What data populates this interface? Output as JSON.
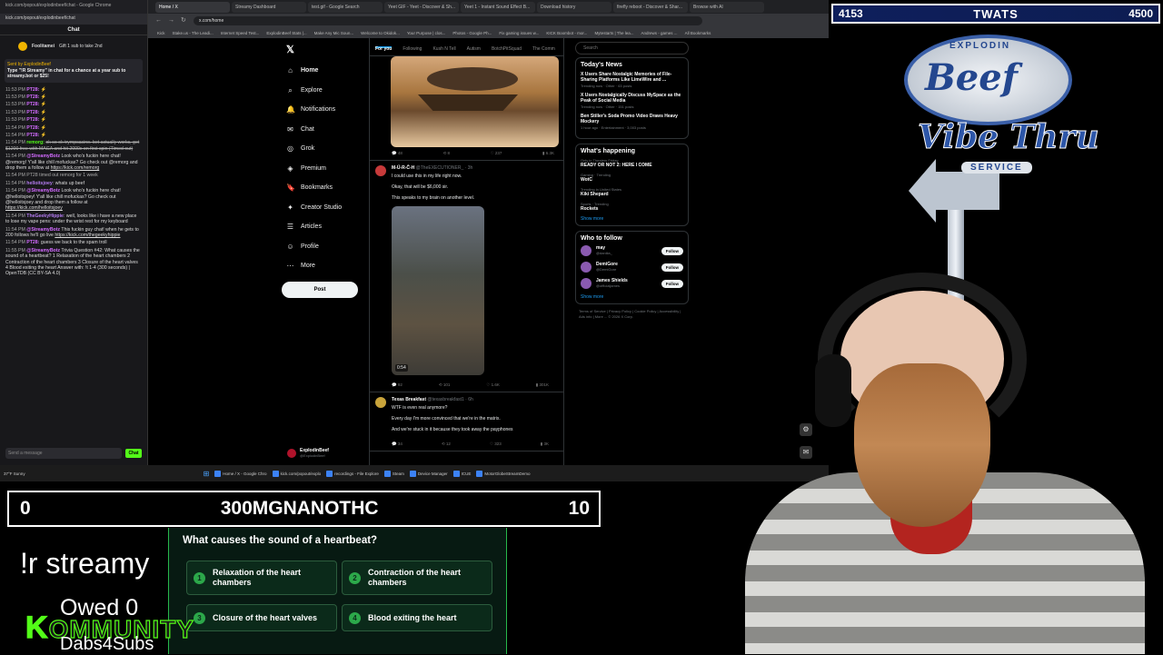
{
  "chat": {
    "title": "kick.com/popout/explodinbeef/chat - Google Chrome",
    "url": "kick.com/popout/explodinbeef/chat",
    "header": "Chat",
    "gift_user": "Foolitamei",
    "gift_text": "Gift 1 sub to take 2nd",
    "pinned_by": "Sent by ExplodinBeef",
    "pinned_text": "Type \"!R Streamy\" in chat for a chance at a year sub to streamy.bot or $25!",
    "lines": [
      {
        "time": "11:53 PM",
        "user": "PT28:",
        "text": "",
        "cls": "p"
      },
      {
        "time": "11:53 PM",
        "user": "PT28:",
        "text": "",
        "cls": "p"
      },
      {
        "time": "11:53 PM",
        "user": "PT28:",
        "text": "",
        "cls": "p"
      },
      {
        "time": "11:53 PM",
        "user": "PT28:",
        "text": "",
        "cls": "p"
      },
      {
        "time": "11:53 PM",
        "user": "PT28:",
        "text": "",
        "cls": "p"
      },
      {
        "time": "11:54 PM",
        "user": "PT28:",
        "text": "",
        "cls": "p"
      },
      {
        "time": "11:54 PM",
        "user": "PT28:",
        "text": "",
        "cls": "p"
      }
    ],
    "remorg_time": "11:54 PM",
    "remorg_user": "remorg:",
    "remorg_text": "ok so ok trympcasino. bet actually works, get $1200 free with MAGA and hit 2000x on first spin (Timed out)",
    "bot1_time": "11:54 PM",
    "bot1_user": "@StreamyBotz",
    "bot1_text": "Look who's fuckin here chat! @remorg! Y'all like chill mofuckas? Go check out @remorg and drop them a follow at",
    "bot1_link": "https://kick.com/remorg",
    "timeout_time": "11:54 PM",
    "timeout_text": "PT28 timed out remorg for 1 week",
    "hello_time": "11:54 PM",
    "hello_user": "helloitsjoey",
    "hello_text": ": whats up beef",
    "bot2_time": "11:54 PM",
    "bot2_user": "@StreamyBotz",
    "bot2_text": "Look who's fuckin here chat! @helloitsjoey! Y'all like chill mofuckas? Go check out @helloitsjoey and drop them a follow at",
    "bot2_link": "https://kick.com/helloitsjoey",
    "geeky_time": "11:54 PM",
    "geeky_user": "TheGeekyHippie",
    "geeky_text": ": well, looks like i have a new place to lose my vape pens: under the wrist rest for my keyboard",
    "bot3_time": "11:54 PM",
    "bot3_user": "@StreamyBotz",
    "bot3_text": "This fuckin guy chat! when he gets to 200 follows he'll go live",
    "bot3_link": "https://kick.com/thegeekyhippie",
    "pt_time": "11:54 PM",
    "pt_user": "PT28:",
    "pt_text": "guess we back to the spam troll",
    "trivia_time": "11:55 PM",
    "trivia_user": "@StreamyBotz",
    "trivia_text": "Trivia Question #42: What causes the sound of a heartbeat? 1 Relaxation of the heart chambers 2 Contraction of the heart chambers 3 Closure of the heart valves 4 Blood exiting the heart Answer with: !t 1-4 (300 seconds) | OpenTDB (CC BY-SA 4.0)",
    "input_placeholder": "Send a message",
    "send_label": "Chat"
  },
  "browser": {
    "tabs": [
      "Home / X",
      "Streamy Dashboard",
      "test.gif - Google Search",
      "Yeet GIF - Yeet - Discover & Sh...",
      "Yeet 1 - Instant Sound Effect B...",
      "Download history",
      "firefly reboot - Discover & Shar...",
      "Browse with AI"
    ],
    "address": "x.com/home",
    "bookmarks": [
      "Kick",
      "Stake.us - The Leadi...",
      "Internet Speed Test...",
      "ExplodinBeef Stats |...",
      "Make Any Mic Soun...",
      "Welcome to Okidok...",
      "Your Purpose | clos...",
      "Photos - Google Ph...",
      "Fix gaming issues w...",
      "KICK Boombot - mor...",
      "Mytestarts | The lea...",
      "Andrews - games ...",
      "All Bookmarks"
    ]
  },
  "x": {
    "nav": [
      "Home",
      "Explore",
      "Notifications",
      "Chat",
      "Grok",
      "Premium",
      "Bookmarks",
      "Creator Studio",
      "Articles",
      "Profile",
      "More"
    ],
    "post_label": "Post",
    "account_name": "ExplodinBeef",
    "account_handle": "@ExplodinBeef",
    "feed_tabs": [
      "For you",
      "Following",
      "Kush N Tell",
      "Autism",
      "BotchPitSquad",
      "The Comm"
    ],
    "tweet0_actions": [
      "48",
      "8",
      "237",
      "6.3K"
    ],
    "tweet1_name": "M-Ü-R-Ĉ-H",
    "tweet1_handle": "@TheEXECUTIONER_ · 3h",
    "tweet1_lines": [
      "I could use this in my life right now.",
      "Okay, that will be $6,000 sir.",
      "This speaks to my brain on another level."
    ],
    "tweet1_video_time": "0:54",
    "tweet1_actions": [
      "92",
      "101",
      "1.6K",
      "301K"
    ],
    "tweet2_name": "Texas Breakfast",
    "tweet2_handle": "@texasbreakfast1 · 6h",
    "tweet2_lines": [
      "WTF is even real anymore?",
      "Every day I'm more convinced that we're in the matrix.",
      "And we're stuck in it because they took away the payphones"
    ],
    "tweet2_actions": [
      "34",
      "12",
      "323",
      "3K"
    ],
    "search_placeholder": "Search",
    "news_title": "Today's News",
    "news": [
      {
        "title": "X Users Share Nostalgic Memories of File-Sharing Platforms Like LimeWire and ...",
        "meta": "Trending now · Other · 63 posts"
      },
      {
        "title": "X Users Nostalgically Discuss MySpace as the Peak of Social Media",
        "meta": "Trending now · Other · 151 posts"
      },
      {
        "title": "Ben Stiller's Soda Promo Video Draws Heavy Mockery",
        "meta": "1 hour ago · Entertainment · 3,003 posts"
      }
    ],
    "happening_title": "What's happening",
    "trends": [
      {
        "cat": "Only in Theaters Friday",
        "name": "READY OR NOT 2: HERE I COME"
      },
      {
        "cat": "Gaming · Trending",
        "name": "WotC"
      },
      {
        "cat": "Trending in United States",
        "name": "Kiki Shepard"
      },
      {
        "cat": "Sports · Trending",
        "name": "Rockets"
      }
    ],
    "show_more": "Show more",
    "follow_title": "Who to follow",
    "follows": [
      {
        "name": "may",
        "handle": "@daniiia_"
      },
      {
        "name": "DemiGore",
        "handle": "@DemiGore"
      },
      {
        "name": "James Shields",
        "handle": "@officialjames"
      }
    ],
    "follow_label": "Follow",
    "footer": "Terms of Service | Privacy Policy | Cookie Policy | Accessibility | Ads info | More ... © 2026 X Corp."
  },
  "taskbar": {
    "weather": "37°F Sunny",
    "items": [
      "Home / X - Google Chro",
      "kick.com/popout/explo",
      "recordings - File Explore",
      "Steam",
      "Device Manager",
      "ICUE",
      "MotorGlobeStreamDemo"
    ]
  },
  "scoreboard": {
    "left": "4153",
    "title": "TWATS",
    "right": "4500"
  },
  "logo": {
    "top": "EXPLODIN",
    "beef": "Beef",
    "vibe": "Vibe Thru",
    "service": "SERVICE"
  },
  "quiz": {
    "left_score": "0",
    "title": "300MGNANOTHC",
    "right_score": "10",
    "question": "What causes the sound of a heartbeat?",
    "answers": [
      {
        "num": "1",
        "text": "Relaxation of the heart chambers"
      },
      {
        "num": "2",
        "text": "Contraction of the heart chambers"
      },
      {
        "num": "3",
        "text": "Closure of the heart valves"
      },
      {
        "num": "4",
        "text": "Blood exiting the heart"
      }
    ]
  },
  "overlay": {
    "streamy": "!r streamy",
    "owed": "Owed 0",
    "kommunity_k": "K",
    "kommunity": "OMMUNITY",
    "dabs": "Dabs4Subs"
  },
  "colors": {
    "kick_green": "#53fc18",
    "x_blue": "#1d9bf0",
    "quiz_green": "#2ca84a"
  }
}
